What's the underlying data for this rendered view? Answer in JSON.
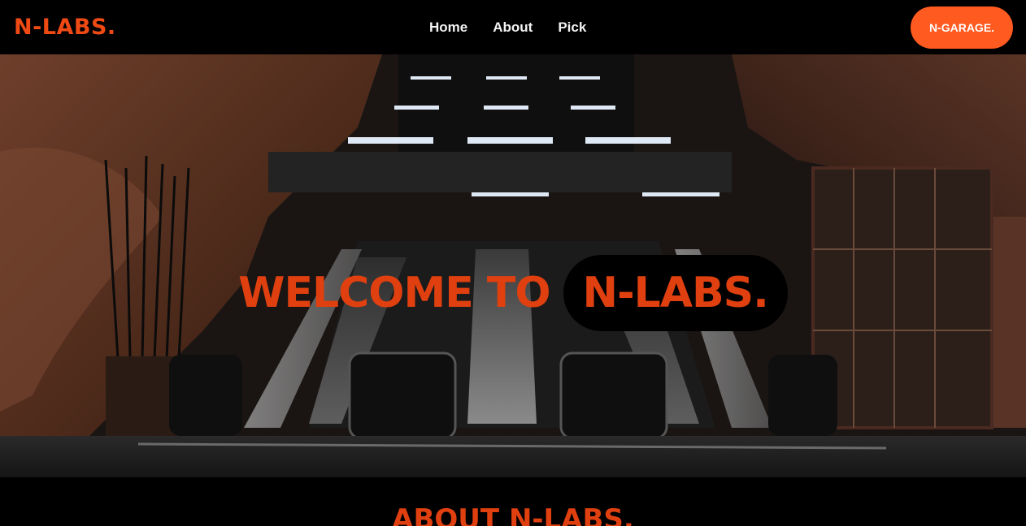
{
  "brand": {
    "logo": "N-LABS.",
    "accent_color": "#ef4a14"
  },
  "nav": {
    "links": [
      "Home",
      "About",
      "Pick"
    ],
    "cta_label": "N-GARAGE."
  },
  "hero": {
    "title_lead": "WELCOME TO",
    "title_highlight": "N-LABS.",
    "background_image": "subway-escalators-photo"
  },
  "about": {
    "heading": "ABOUT N-LABS."
  }
}
